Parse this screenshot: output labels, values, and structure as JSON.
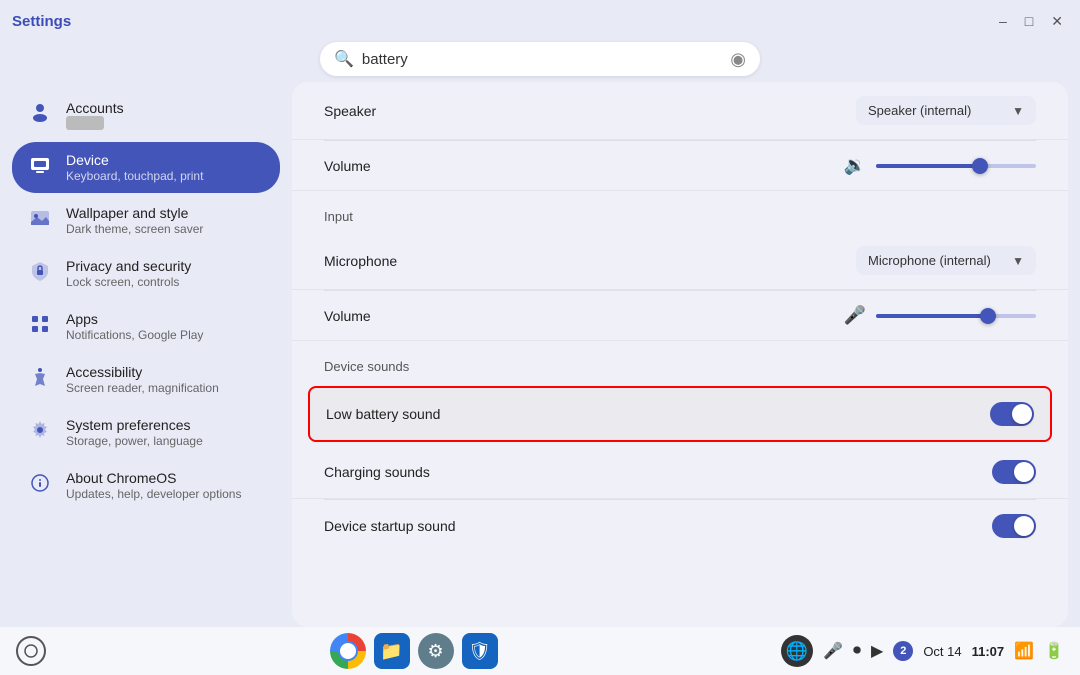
{
  "titleBar": {
    "title": "Settings",
    "controls": [
      "minimize",
      "maximize",
      "close"
    ]
  },
  "search": {
    "placeholder": "battery",
    "value": "battery",
    "clear_label": "✕"
  },
  "sidebar": {
    "items": [
      {
        "id": "accounts",
        "icon": "👤",
        "label": "Accounts",
        "sublabel": "",
        "active": false
      },
      {
        "id": "device",
        "icon": "💻",
        "label": "Device",
        "sublabel": "Keyboard, touchpad, print",
        "active": true
      },
      {
        "id": "wallpaper",
        "icon": "🎨",
        "label": "Wallpaper and style",
        "sublabel": "Dark theme, screen saver",
        "active": false
      },
      {
        "id": "privacy",
        "icon": "🔒",
        "label": "Privacy and security",
        "sublabel": "Lock screen, controls",
        "active": false
      },
      {
        "id": "apps",
        "icon": "⊞",
        "label": "Apps",
        "sublabel": "Notifications, Google Play",
        "active": false
      },
      {
        "id": "accessibility",
        "icon": "♿",
        "label": "Accessibility",
        "sublabel": "Screen reader, magnification",
        "active": false
      },
      {
        "id": "system",
        "icon": "⚙",
        "label": "System preferences",
        "sublabel": "Storage, power, language",
        "active": false
      },
      {
        "id": "about",
        "icon": "ℹ",
        "label": "About ChromeOS",
        "sublabel": "Updates, help, developer options",
        "active": false
      }
    ]
  },
  "content": {
    "sections": [
      {
        "id": "output",
        "rows": [
          {
            "id": "speaker",
            "label": "Speaker",
            "control_type": "dropdown",
            "dropdown_value": "Speaker (internal)"
          },
          {
            "id": "output-volume",
            "label": "Volume",
            "control_type": "slider",
            "icon": "🔉",
            "fill_pct": 65
          }
        ]
      },
      {
        "id": "input",
        "label": "Input",
        "rows": [
          {
            "id": "microphone",
            "label": "Microphone",
            "control_type": "dropdown",
            "dropdown_value": "Microphone (internal)"
          },
          {
            "id": "input-volume",
            "label": "Volume",
            "control_type": "slider",
            "icon": "🎤",
            "fill_pct": 70
          }
        ]
      },
      {
        "id": "device-sounds",
        "label": "Device sounds",
        "rows": [
          {
            "id": "low-battery-sound",
            "label": "Low battery sound",
            "control_type": "toggle",
            "toggle_on": true,
            "highlighted": true
          },
          {
            "id": "charging-sounds",
            "label": "Charging sounds",
            "control_type": "toggle",
            "toggle_on": true,
            "highlighted": false
          },
          {
            "id": "device-startup-sound",
            "label": "Device startup sound",
            "control_type": "toggle",
            "toggle_on": true,
            "highlighted": false
          }
        ]
      }
    ]
  },
  "taskbar": {
    "apps": [
      {
        "id": "chrome",
        "label": "Chrome"
      },
      {
        "id": "files",
        "label": "Files"
      },
      {
        "id": "settings",
        "label": "Settings"
      },
      {
        "id": "taskbar-blue",
        "label": "App"
      }
    ],
    "date": "Oct 14",
    "time": "11:07",
    "wifi_icon": "📶",
    "battery_icon": "🔋"
  }
}
